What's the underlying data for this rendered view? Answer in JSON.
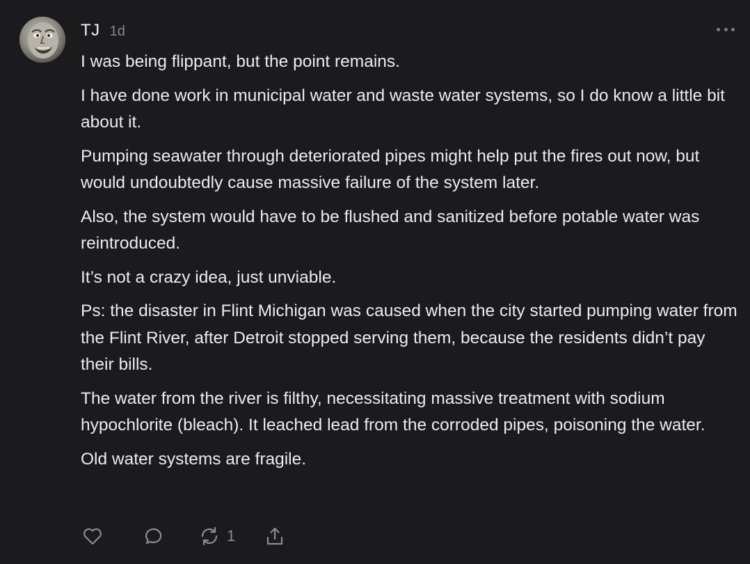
{
  "comment": {
    "author": "TJ",
    "time": "1d",
    "paragraphs": [
      "I was being flippant, but the point remains.",
      "I have done work in municipal water and waste water systems, so I do know a little bit about it.",
      "Pumping seawater through deteriorated pipes might help put the fires out now, but would undoubtedly cause massive failure of the system later.",
      "Also, the system would have to be flushed and sanitized before potable water was reintroduced.",
      "It’s not a crazy idea, just unviable.",
      "Ps: the disaster in Flint Michigan was caused when the city started pumping water from the Flint River, after Detroit stopped serving them, because the residents didn’t pay their bills.",
      "The water from the river is filthy, necessitating massive treatment with sodium hypochlorite (bleach). It leached lead from the corroded pipes, poisoning the water.",
      "Old water systems are fragile."
    ]
  },
  "actions": {
    "like_icon": "heart-icon",
    "reply_icon": "speech-bubble-icon",
    "restack_icon": "restack-arrows-icon",
    "restack_count": "1",
    "share_icon": "share-upload-icon"
  },
  "colors": {
    "background": "#1b1b1d",
    "text": "#ececee",
    "muted": "#8e8e92"
  }
}
